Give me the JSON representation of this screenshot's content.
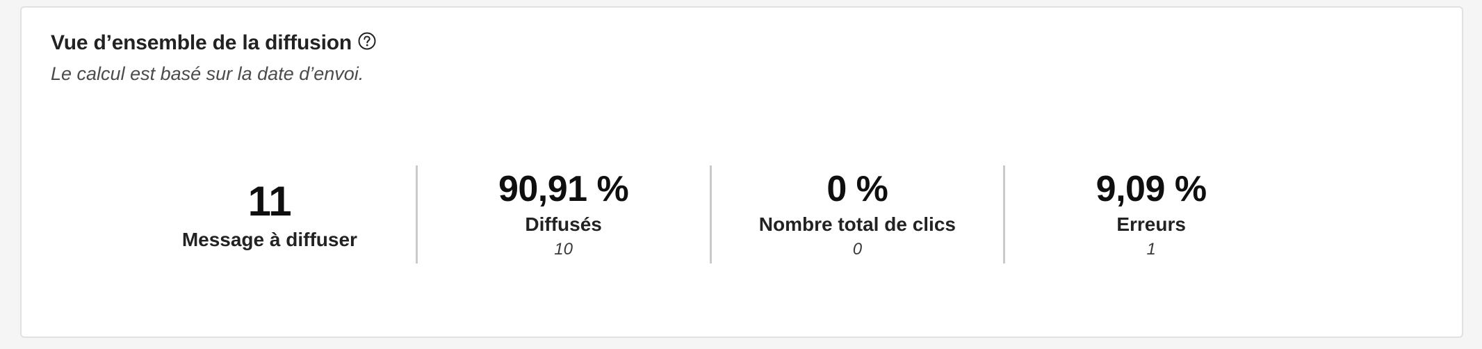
{
  "panel": {
    "title": "Vue d’ensemble de la diffusion",
    "subtitle": "Le calcul est basé sur la date d’envoi.",
    "help_icon": "help-circle-icon"
  },
  "metrics": [
    {
      "value": "11",
      "label": "Message à diffuser"
    },
    {
      "value": "90,91 %",
      "label": "Diffusés",
      "count": "10"
    },
    {
      "value": "0 %",
      "label": "Nombre total de clics",
      "count": "0"
    },
    {
      "value": "9,09 %",
      "label": "Erreurs",
      "count": "1"
    }
  ],
  "colors": {
    "background": "#f5f5f5",
    "card": "#ffffff",
    "divider": "#cacaca",
    "text": "#1a1a1a"
  }
}
